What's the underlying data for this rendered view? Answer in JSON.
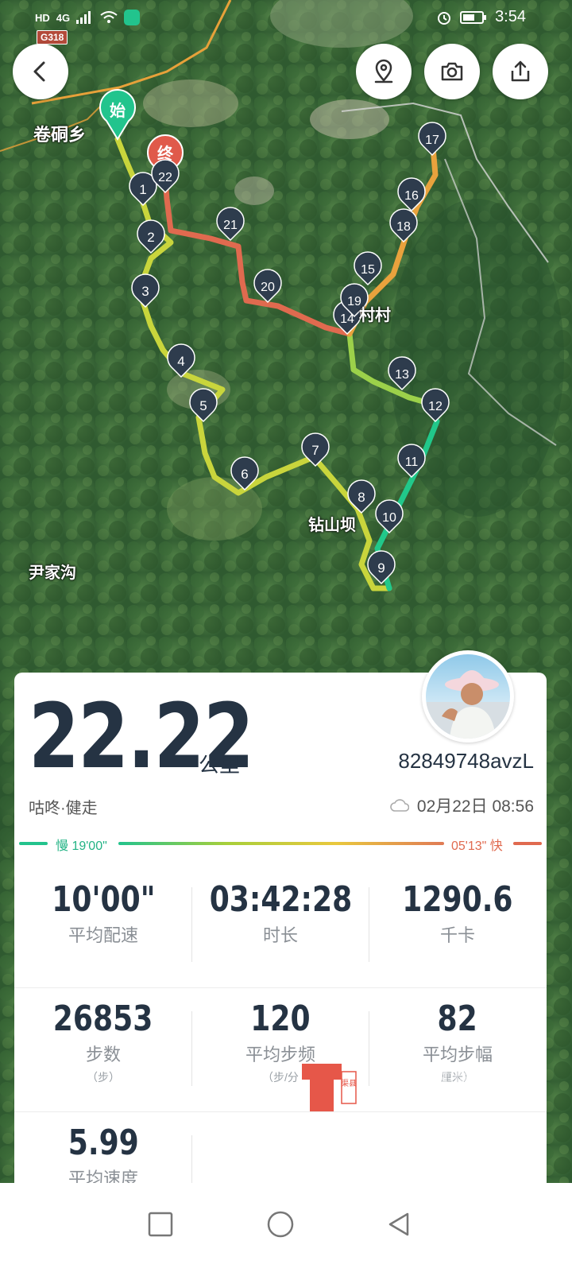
{
  "status_bar": {
    "time": "3:54",
    "network": "4G",
    "hd": "HD"
  },
  "map": {
    "road_tag": "G318",
    "start_label": "始",
    "end_label": "终",
    "places": [
      "卷硐乡",
      "尹家沟",
      "钻山坝",
      "村村"
    ],
    "waypoints": [
      "1",
      "2",
      "3",
      "4",
      "5",
      "6",
      "7",
      "8",
      "9",
      "10",
      "11",
      "12",
      "13",
      "14",
      "15",
      "16",
      "17",
      "18",
      "19",
      "20",
      "21",
      "22"
    ]
  },
  "toolbar": {
    "back_icon": "chevron-left-icon",
    "location_icon": "map-pin-icon",
    "camera_icon": "camera-icon",
    "share_icon": "share-icon"
  },
  "summary": {
    "distance": "22.22",
    "distance_unit": "公里",
    "username": "82849748avzL",
    "activity": "咕咚·健走",
    "datetime": "02月22日 08:56",
    "weather_icon": "cloud-icon"
  },
  "pace_legend": {
    "slow": "慢 19'00\"",
    "fast": "05'13\" 快",
    "slow_color": "#23c38d",
    "fast_color": "#e06a4f"
  },
  "stats": [
    {
      "value": "10'00\"",
      "label": "平均配速",
      "sub": ""
    },
    {
      "value": "03:42:28",
      "label": "时长",
      "sub": ""
    },
    {
      "value": "1290.6",
      "label": "千卡",
      "sub": ""
    },
    {
      "value": "26853",
      "label": "步数",
      "sub": "（步）"
    },
    {
      "value": "120",
      "label": "平均步频",
      "sub": "（步/分"
    },
    {
      "value": "82",
      "label": "平均步幅",
      "sub": "厘米）"
    },
    {
      "value": "5.99",
      "label": "平均速度",
      "sub": ""
    }
  ],
  "watermark": {
    "text": "渠县网",
    "seal": "渠县"
  }
}
